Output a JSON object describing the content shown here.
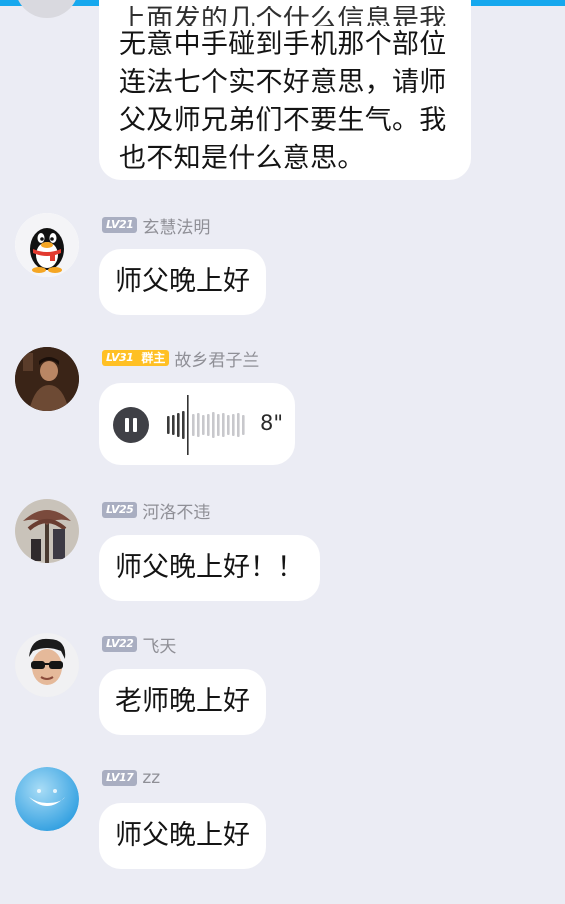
{
  "status_bar": {
    "icon": "status-dot-icon",
    "accent": "#16a8ee"
  },
  "top_message": {
    "lines": [
      "上面发的几个什么信息是我",
      "无意中手碰到手机那个部位",
      "连法七个实不好意思，请师",
      "父及师兄弟们不要生气。我",
      "也不知是什么意思。"
    ]
  },
  "messages": [
    {
      "avatar": "penguin-avatar-icon",
      "level": "LV21",
      "username": "玄慧法明",
      "type": "text",
      "text": "师父晚上好"
    },
    {
      "avatar": "photo-avatar-dark",
      "level": "LV31",
      "role": "群主",
      "username": "故乡君子兰",
      "type": "voice",
      "duration": "8\"",
      "playback_progress": 0.25,
      "state_icon": "pause-icon"
    },
    {
      "avatar": "photo-avatar-tree",
      "level": "LV25",
      "username": "河洛不违",
      "type": "text",
      "text": "师父晚上好！！"
    },
    {
      "avatar": "photo-avatar-sunglasses",
      "level": "LV22",
      "username": "飞天",
      "type": "text",
      "text": "老师晚上好"
    },
    {
      "avatar": "smile-avatar-icon",
      "level": "LV17",
      "username": "zz",
      "type": "text",
      "text": "师父晚上好"
    }
  ],
  "colors": {
    "background": "#ebecf4",
    "bubble": "#ffffff",
    "level_badge": "#a9aec1",
    "owner_badge": "#ffc024",
    "username": "#8f8f96"
  }
}
